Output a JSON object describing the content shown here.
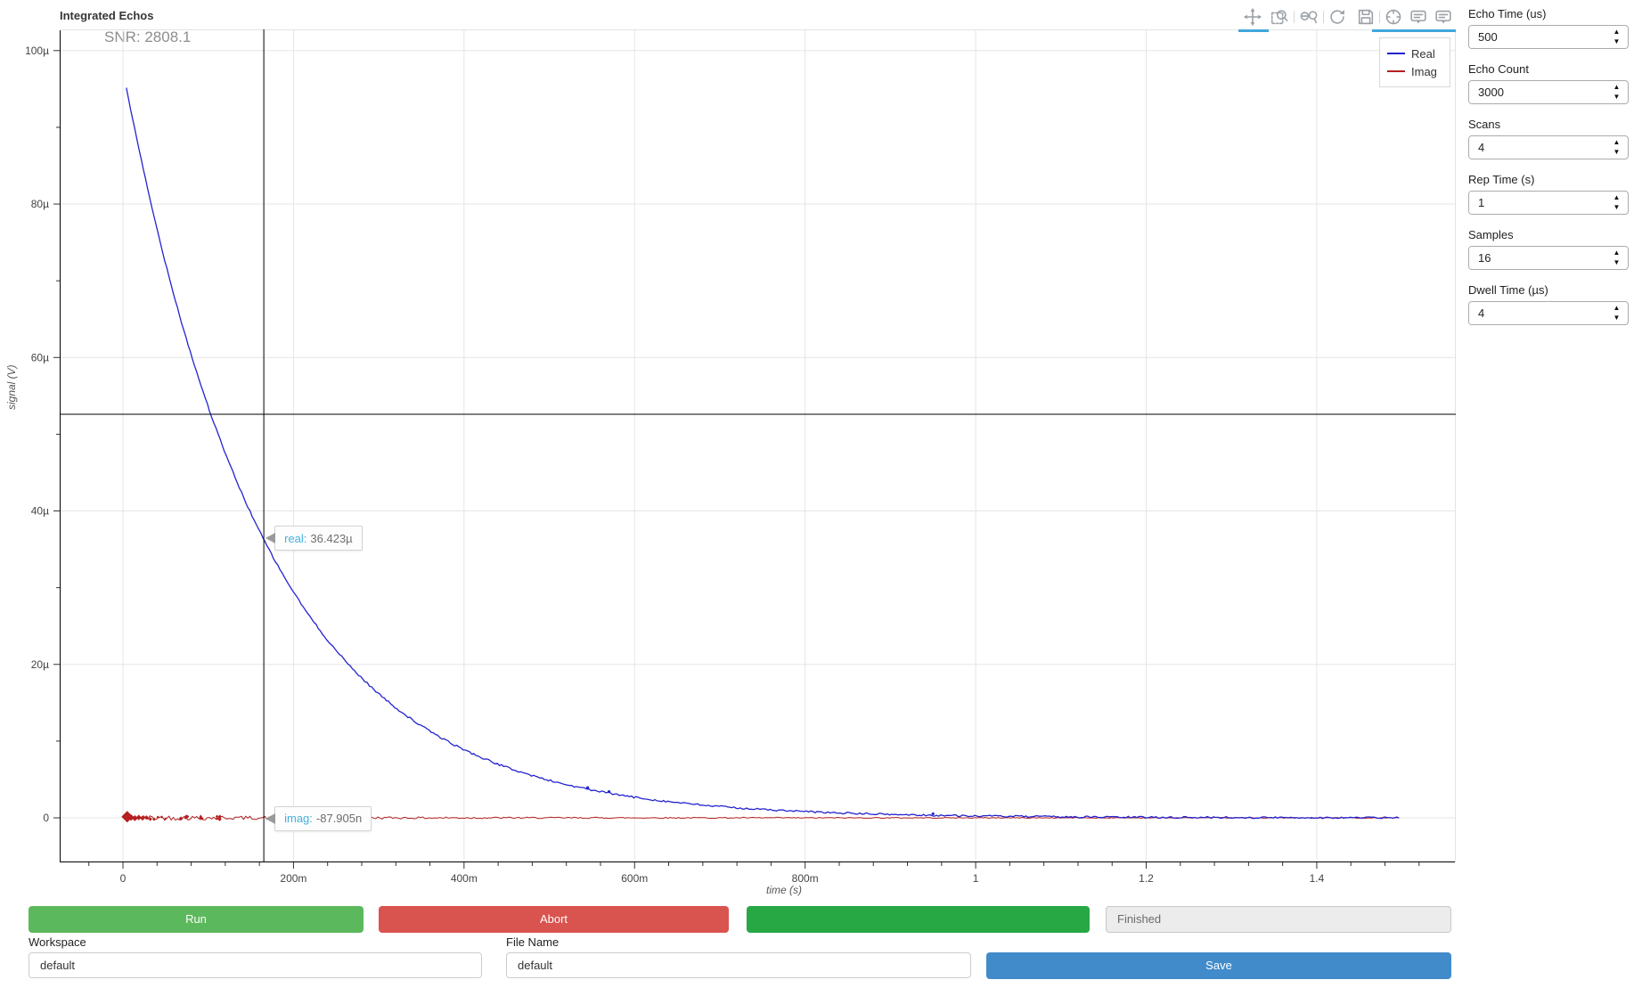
{
  "plot": {
    "title": "Integrated Echos",
    "snr": "SNR: 2808.1",
    "xlabel": "time (s)",
    "ylabel": "signal (V)",
    "legend": [
      {
        "label": "Real",
        "color": "#2323cf"
      },
      {
        "label": "Imag",
        "color": "#b52020"
      }
    ],
    "tooltips": {
      "real_label": "real:",
      "real_value": "36.423µ",
      "imag_label": "imag:",
      "imag_value": "-87.905n"
    }
  },
  "chart_data": {
    "type": "line",
    "title": "Integrated Echos",
    "annotation": "SNR: 2808.1",
    "xlabel": "time (s)",
    "ylabel": "signal (V)",
    "x_range_s": [
      -0.074,
      1.563
    ],
    "y_range_uV": [
      -5.8,
      102.8
    ],
    "grid": true,
    "legend_position": "top-right",
    "x_tick_values_s": [
      0,
      0.2,
      0.4,
      0.6,
      0.8,
      1.0,
      1.2,
      1.4
    ],
    "x_tick_labels": [
      "0",
      "200m",
      "400m",
      "600m",
      "800m",
      "1",
      "1.2",
      "1.4"
    ],
    "y_tick_values_uV": [
      0,
      20,
      40,
      60,
      80,
      100
    ],
    "y_tick_labels": [
      "0",
      "20µ",
      "40µ",
      "60µ",
      "80µ",
      "100µ"
    ],
    "series": [
      {
        "name": "Real",
        "color": "#2323cf",
        "model": "A*exp(-t/tau) + small noise",
        "A_uV": 97.5,
        "tau_s": 0.167,
        "t_start_s": 0.004,
        "t_end_s": 1.4975,
        "sampled_points": {
          "t_s": [
            0,
            0.1,
            0.165,
            0.2,
            0.3,
            0.4,
            0.5,
            0.6,
            0.7,
            0.8,
            0.9,
            1.0,
            1.1,
            1.2,
            1.3,
            1.4,
            1.5
          ],
          "signal_uV": [
            97.5,
            53.5,
            36.42,
            29.4,
            16.1,
            8.85,
            4.86,
            2.67,
            1.46,
            0.8,
            0.44,
            0.24,
            0.13,
            0.073,
            0.04,
            0.022,
            0.012
          ]
        }
      },
      {
        "name": "Imag",
        "color": "#b52020",
        "model": "zero-mean noise, diamond markers near t=0",
        "mean_uV": 0,
        "noise_amp_uV": 0.32,
        "t_start_s": 0.004,
        "t_end_s": 1.4975
      }
    ],
    "cursor": {
      "t_s": 0.1652,
      "crosshair_y_uV": 52.6,
      "real_uV": 36.423,
      "imag_nV": -87.905
    }
  },
  "toolbar": {
    "icons": [
      "pan",
      "box-zoom",
      "zoom-in-out",
      "reset-axes",
      "save-plot",
      "crosshair",
      "tooltip-closest",
      "tooltip-compare"
    ],
    "active": [
      "pan",
      "crosshair",
      "tooltip-closest",
      "tooltip-compare"
    ]
  },
  "controls": [
    {
      "label": "Echo Time (us)",
      "value": "500"
    },
    {
      "label": "Echo Count",
      "value": "3000"
    },
    {
      "label": "Scans",
      "value": "4"
    },
    {
      "label": "Rep Time (s)",
      "value": "1"
    },
    {
      "label": "Samples",
      "value": "16"
    },
    {
      "label": "Dwell Time (µs)",
      "value": "4"
    }
  ],
  "actions": {
    "run": "Run",
    "abort": "Abort",
    "status": "Finished",
    "save": "Save"
  },
  "fields": {
    "workspace_label": "Workspace",
    "workspace_value": "default",
    "filename_label": "File Name",
    "filename_value": "default"
  }
}
